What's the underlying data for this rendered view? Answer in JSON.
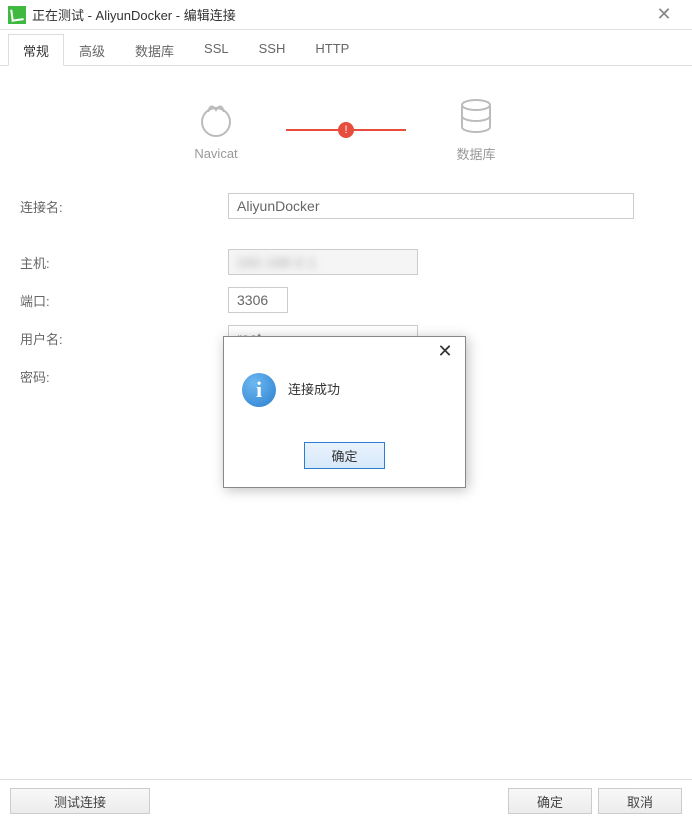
{
  "titlebar": {
    "text": "正在测试 - AliyunDocker - 编辑连接"
  },
  "tabs": [
    {
      "label": "常规",
      "active": true
    },
    {
      "label": "高级",
      "active": false
    },
    {
      "label": "数据库",
      "active": false
    },
    {
      "label": "SSL",
      "active": false
    },
    {
      "label": "SSH",
      "active": false
    },
    {
      "label": "HTTP",
      "active": false
    }
  ],
  "diagram": {
    "left_label": "Navicat",
    "right_label": "数据库",
    "badge": "!"
  },
  "form": {
    "connection_name": {
      "label": "连接名:",
      "value": "AliyunDocker"
    },
    "host": {
      "label": "主机:",
      "value": ""
    },
    "port": {
      "label": "端口:",
      "value": "3306"
    },
    "username": {
      "label": "用户名:",
      "value": "root"
    },
    "password": {
      "label": "密码:",
      "value": ""
    }
  },
  "bottombar": {
    "test": "测试连接",
    "ok": "确定",
    "cancel": "取消"
  },
  "modal": {
    "message": "连接成功",
    "ok": "确定"
  }
}
